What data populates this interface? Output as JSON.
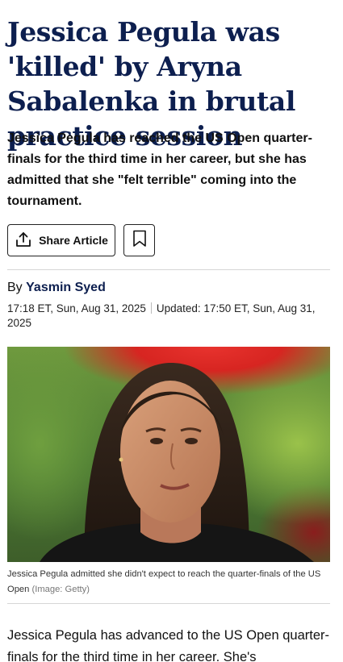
{
  "article": {
    "headline": "Jessica Pegula was 'killed' by Aryna Sabalenka in brutal practice session",
    "standfirst": "Jessica Pegula has reached the US Open quarter-finals for the third time in her career, but she has admitted that she \"felt terrible\" coming into the tournament.",
    "share_label": "Share Article",
    "byline_prefix": "By",
    "author": "Yasmin Syed",
    "published": "17:18 ET, Sun, Aug 31, 2025",
    "updated": "Updated: 17:50 ET, Sun, Aug 31, 2025",
    "image_caption": "Jessica Pegula admitted she didn't expect to reach the quarter-finals of the US Open",
    "image_credit": "(Image: Getty)",
    "body_first": "Jessica Pegula has advanced to the US Open quarter-finals for the third time in her career. She's"
  },
  "icons": {
    "share": "share-icon",
    "bookmark": "bookmark-icon"
  }
}
